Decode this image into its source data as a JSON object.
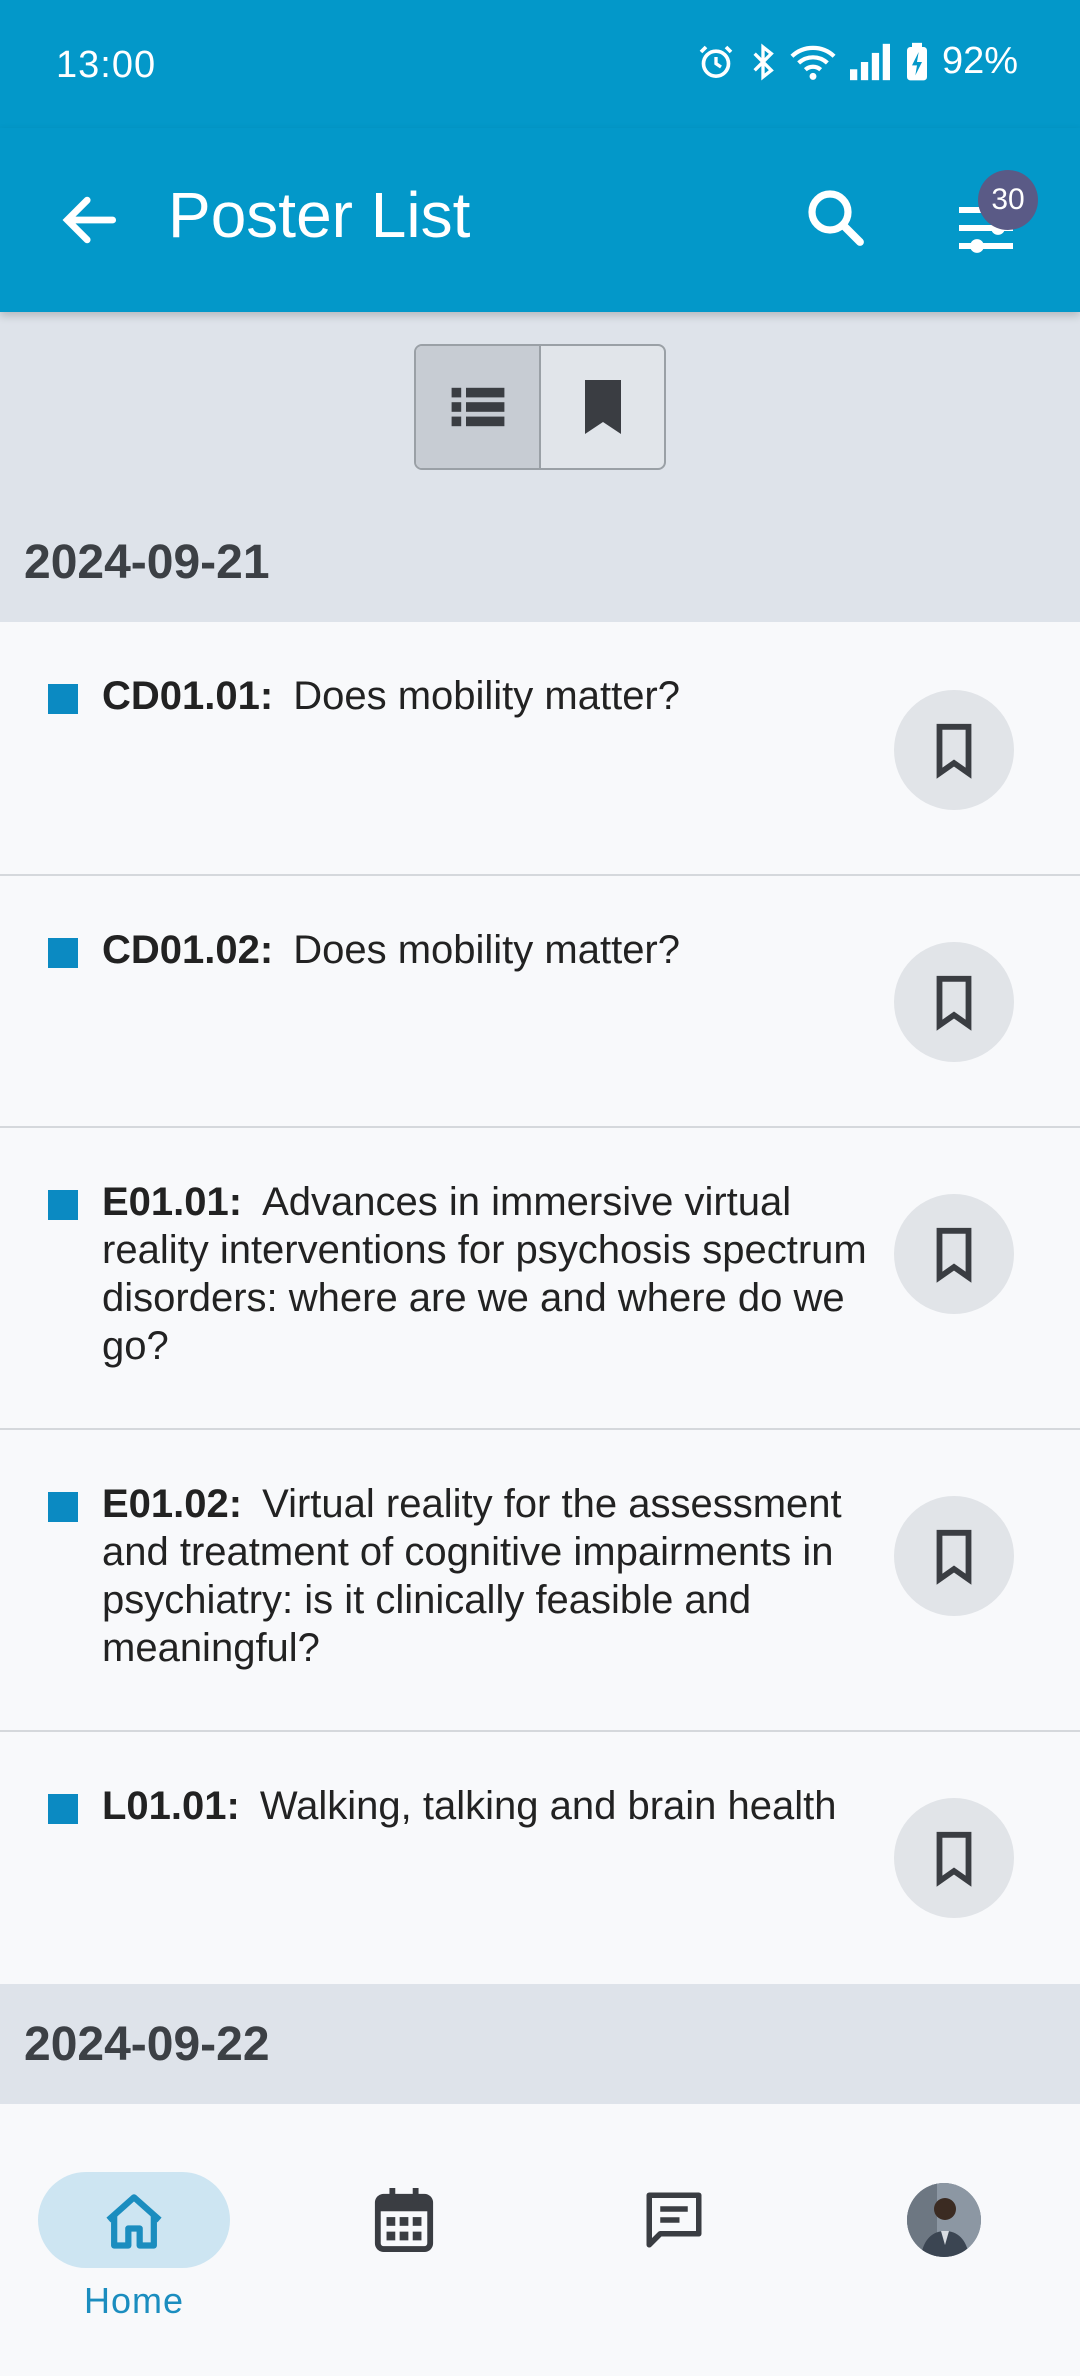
{
  "status": {
    "time": "13:00",
    "battery": "92%"
  },
  "appbar": {
    "title": "Poster List",
    "filter_count": "30"
  },
  "view_toggle": {
    "list_icon": "list-icon",
    "bookmarked_icon": "bookmark-filled-icon"
  },
  "sections": [
    {
      "date": "2024-09-21",
      "posters": [
        {
          "code": "CD01.01:",
          "title": "Does mobility matter?"
        },
        {
          "code": "CD01.02:",
          "title": "Does mobility matter?"
        },
        {
          "code": "E01.01:",
          "title": "Advances in immersive virtual reality interventions for psychosis spectrum disorders: where are we and where do we go?"
        },
        {
          "code": "E01.02:",
          "title": "Virtual reality for the assessment and treatment of cognitive impairments in psychiatry: is it clinically feasible and meaningful?"
        },
        {
          "code": "L01.01:",
          "title": "Walking, talking and brain health"
        }
      ]
    },
    {
      "date": "2024-09-22",
      "posters": []
    }
  ],
  "nav": {
    "home_label": "Home"
  },
  "colors": {
    "primary": "#0398c9",
    "bullet": "#0b8ac2",
    "badge": "#5a5a86",
    "nav_active": "#cde5f2"
  }
}
